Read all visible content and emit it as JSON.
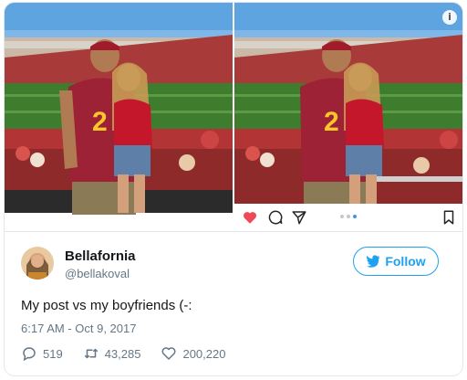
{
  "tweet": {
    "display_name": "Bellafornia",
    "handle": "@bellakoval",
    "follow_label": "Follow",
    "text": "My post vs my boyfriends (-:",
    "timestamp": "6:17 AM - Oct 9, 2017",
    "replies": "519",
    "retweets": "43,285",
    "likes": "200,220"
  },
  "media": {
    "info_glyph": "i",
    "icons": [
      "heart-icon",
      "comment-icon",
      "share-icon",
      "bookmark-icon",
      "info-icon"
    ]
  },
  "colors": {
    "accent": "#1da1f2",
    "muted": "#657786",
    "heart": "#ed4956",
    "jersey": "#9d2235",
    "gold": "#ffc72c"
  }
}
